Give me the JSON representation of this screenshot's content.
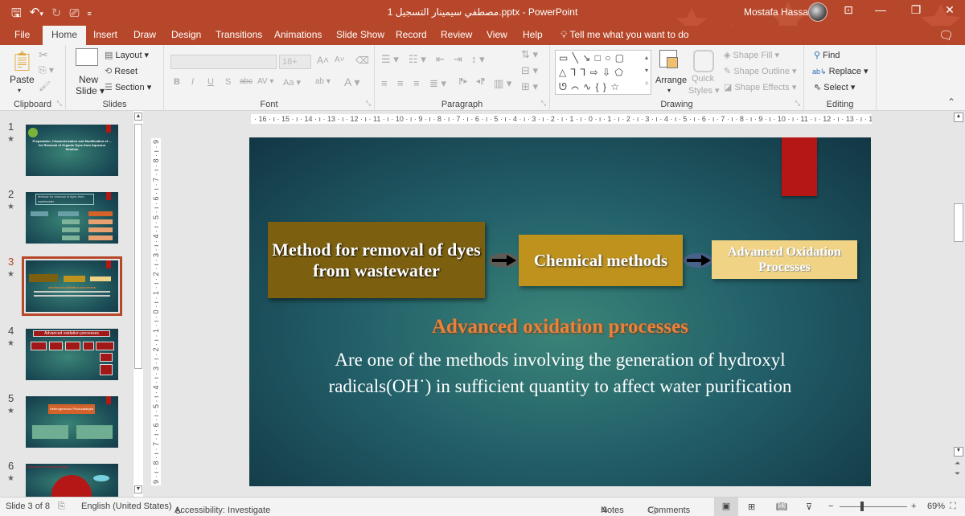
{
  "window": {
    "title": "مصطفي سيمينار التسجيل 1.pptx - PowerPoint",
    "user_name": "Mostafa Hassan",
    "accent_color": "#b7472a"
  },
  "quick_access": {
    "save": "save-icon",
    "undo": "undo-icon",
    "redo": "redo-icon",
    "present": "present-from-start-icon",
    "customize": "customize-qat-icon"
  },
  "tabs": [
    {
      "label": "File"
    },
    {
      "label": "Home",
      "active": true
    },
    {
      "label": "Insert"
    },
    {
      "label": "Draw"
    },
    {
      "label": "Design"
    },
    {
      "label": "Transitions"
    },
    {
      "label": "Animations"
    },
    {
      "label": "Slide Show"
    },
    {
      "label": "Record"
    },
    {
      "label": "Review"
    },
    {
      "label": "View"
    },
    {
      "label": "Help"
    }
  ],
  "tell_me": "Tell me what you want to do",
  "ribbon": {
    "clipboard": {
      "label": "Clipboard",
      "paste": "Paste"
    },
    "slides": {
      "label": "Slides",
      "new_slide_1": "New",
      "new_slide_2": "Slide",
      "layout": "Layout",
      "reset": "Reset",
      "section": "Section"
    },
    "font": {
      "label": "Font",
      "font_name": "",
      "font_size": "18+"
    },
    "paragraph": {
      "label": "Paragraph"
    },
    "drawing": {
      "label": "Drawing",
      "arrange": "Arrange",
      "quick_styles_1": "Quick",
      "quick_styles_2": "Styles",
      "shape_fill": "Shape Fill",
      "shape_outline": "Shape Outline",
      "shape_effects": "Shape Effects"
    },
    "editing": {
      "label": "Editing",
      "find": "Find",
      "replace": "Replace",
      "select": "Select"
    }
  },
  "ruler": {
    "horizontal": "· 16 · ı · 15 · ı · 14 · ı · 13 · ı · 12 · ı · 11 · ı · 10 · ı · 9 · ı · 8 · ı · 7 · ı · 6 · ı · 5 · ı · 4 · ı · 3 · ı · 2 · ı · 1 · ı · 0 · ı · 1 · ı · 2 · ı · 3 · ı · 4 · ı · 5 · ı · 6 · ı · 7 · ı · 8 · ı · 9 · ı · 10 · ı · 11 · ı · 12 · ı · 13 · ı · 14 · ı · 15 · ı · 16 · ı ·",
    "vertical": "9 · ı · 8 · ı · 7 · ı · 6 · ı · 5 · ı · 4 · ı · 3 · ı · 2 · ı · 1 · ı · 0 · ı · 1 · ı · 2 · ı · 3 · ı · 4 · ı · 5 · ı · 6 · ı · 7 · ı · 8 · ı · 9"
  },
  "thumbnails": [
    {
      "number": "1",
      "title": "Preparation, Characterization and Modification of ... for Removal of Organic Dyes from Aqueous Solution"
    },
    {
      "number": "2",
      "title": "Method for removal of dyes from wastewater"
    },
    {
      "number": "3",
      "title": "Advanced oxidation processes",
      "selected": true
    },
    {
      "number": "4",
      "title": "Advanced oxidation processes"
    },
    {
      "number": "5",
      "title": "Heterogeneous Photocatalysis"
    },
    {
      "number": "6",
      "title": "Mechanism of photocatalysis"
    }
  ],
  "slide": {
    "box1": "Method for removal of dyes from wastewater",
    "box2": "Chemical methods",
    "box3": "Advanced Oxidation Processes",
    "heading": "Advanced oxidation processes",
    "body_line1": "Are one of the methods involving the generation of hydroxyl",
    "body_line2": "radicals(OH˙) in sufficient quantity to affect water purification",
    "colors": {
      "box1": "#7c6010",
      "box2": "#be921c",
      "box3": "#f0d384",
      "heading": "#e8823c",
      "red_bar": "#b51616"
    }
  },
  "status": {
    "slide_info": "Slide 3 of 8",
    "language": "English (United States)",
    "accessibility": "Accessibility: Investigate",
    "notes": "Notes",
    "comments": "Comments",
    "zoom": "69%",
    "zoom_minus": "−",
    "zoom_plus": "+"
  }
}
